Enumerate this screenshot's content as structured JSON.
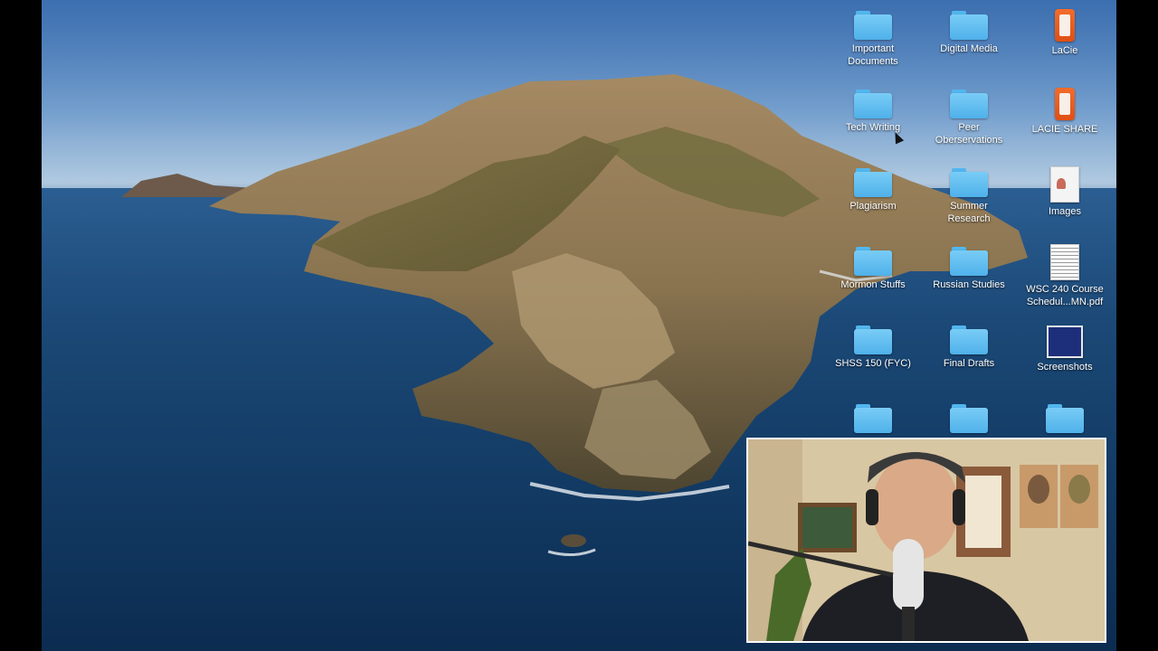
{
  "desktop": {
    "icons": [
      {
        "name": "folder-important-documents",
        "kind": "folder",
        "label": "Important\nDocuments"
      },
      {
        "name": "folder-digital-media",
        "kind": "folder",
        "label": "Digital Media"
      },
      {
        "name": "drive-lacie",
        "kind": "drive",
        "label": "LaCie"
      },
      {
        "name": "folder-tech-writing",
        "kind": "folder",
        "label": "Tech Writing"
      },
      {
        "name": "folder-peer-oberservations",
        "kind": "folder",
        "label": "Peer\nOberservations"
      },
      {
        "name": "drive-lacie-share",
        "kind": "drive",
        "label": "LACIE SHARE"
      },
      {
        "name": "folder-plagiarism",
        "kind": "folder",
        "label": "Plagiarism"
      },
      {
        "name": "folder-summer-research",
        "kind": "folder",
        "label": "Summer\nResearch"
      },
      {
        "name": "file-images",
        "kind": "image-doc",
        "label": "Images"
      },
      {
        "name": "folder-mormon-stuffs",
        "kind": "folder",
        "label": "Mormon Stuffs"
      },
      {
        "name": "folder-russian-studies",
        "kind": "folder",
        "label": "Russian Studies"
      },
      {
        "name": "file-wsc-240-pdf",
        "kind": "pdf",
        "label": "WSC 240 Course\nSchedul...MN.pdf"
      },
      {
        "name": "folder-shss-150",
        "kind": "folder",
        "label": "SHSS 150 (FYC)"
      },
      {
        "name": "folder-final-drafts",
        "kind": "folder",
        "label": "Final Drafts"
      },
      {
        "name": "folder-screenshots",
        "kind": "screenshot",
        "label": "Screenshots"
      },
      {
        "name": "folder-unlabeled-1",
        "kind": "folder",
        "label": ""
      },
      {
        "name": "folder-unlabeled-2",
        "kind": "folder",
        "label": ""
      },
      {
        "name": "folder-unlabeled-3",
        "kind": "folder",
        "label": ""
      }
    ]
  },
  "colors": {
    "folder": "#5fbdf0",
    "drive": "#e9591c",
    "label_text": "#ffffff"
  }
}
